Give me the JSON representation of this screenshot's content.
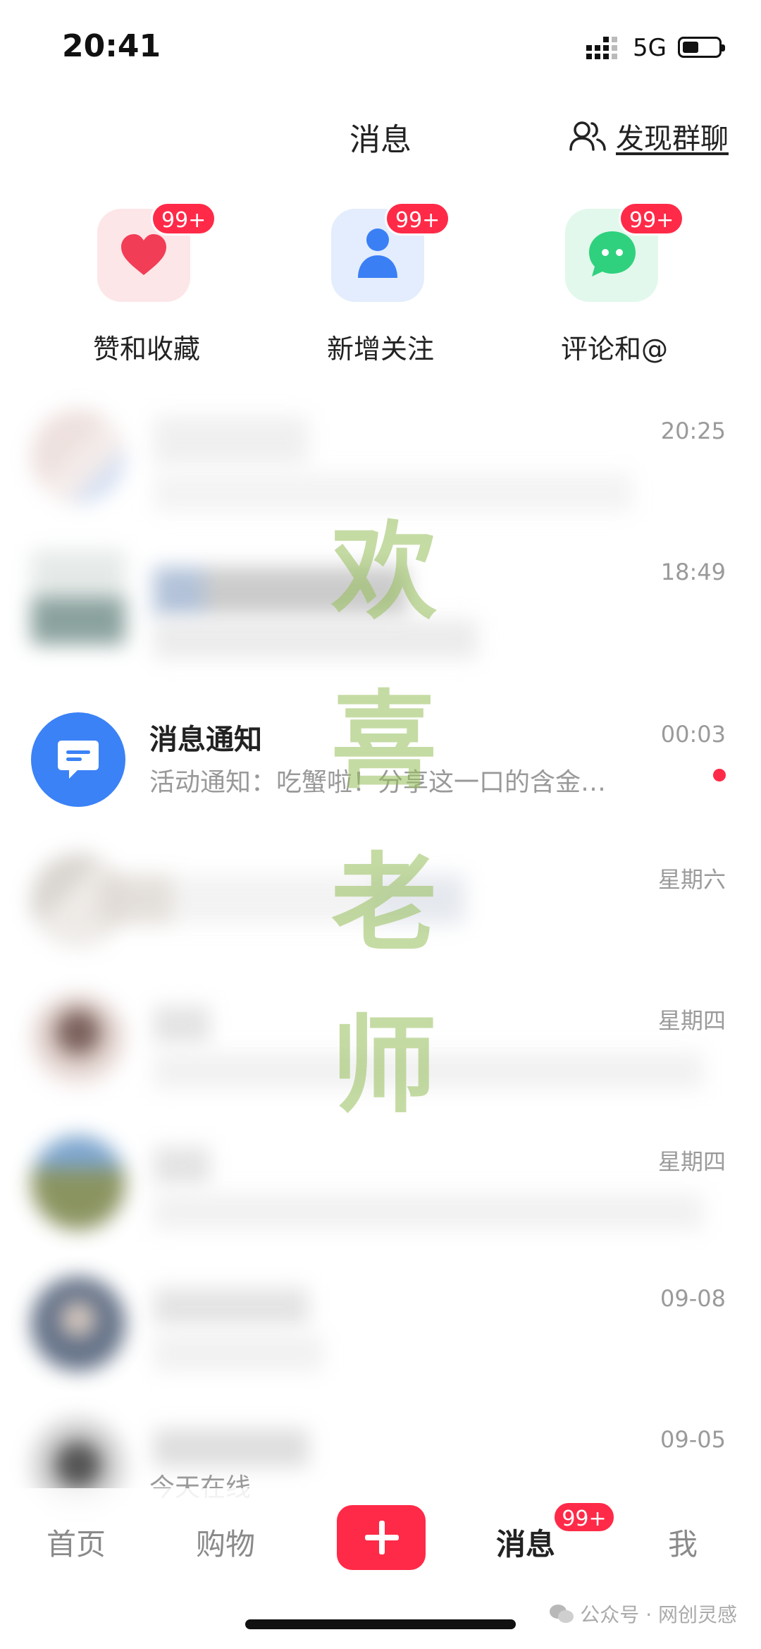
{
  "status_bar": {
    "time": "20:41",
    "network": "5G"
  },
  "header": {
    "title": "消息",
    "discover_label": "发现群聊"
  },
  "quick_actions": [
    {
      "label": "赞和收藏",
      "badge": "99+",
      "icon": "heart-icon",
      "color": "#f23d56"
    },
    {
      "label": "新增关注",
      "badge": "99+",
      "icon": "person-icon",
      "color": "#3b7ff5"
    },
    {
      "label": "评论和@",
      "badge": "99+",
      "icon": "chat-bubble-icon",
      "color": "#2fd17e"
    }
  ],
  "messages": [
    {
      "name": "",
      "preview": "",
      "time": "20:25"
    },
    {
      "name": "",
      "preview": "",
      "time": "18:49"
    },
    {
      "name": "消息通知",
      "preview": "活动通知：吃蟹啦！分享这一口的含金…",
      "time": "00:03",
      "unread": true,
      "icon": "notification-icon"
    },
    {
      "name": "",
      "preview": "",
      "time": "星期六"
    },
    {
      "name": "",
      "preview": "",
      "time": "星期四"
    },
    {
      "name": "",
      "preview": "",
      "time": "星期四"
    },
    {
      "name": "",
      "preview": "",
      "time": "09-08"
    },
    {
      "name": "",
      "preview": "今天在线",
      "time": "09-05"
    }
  ],
  "watermark": [
    "欢",
    "喜",
    "老",
    "师"
  ],
  "tab_bar": {
    "home": "首页",
    "shop": "购物",
    "messages": "消息",
    "messages_badge": "99+",
    "me": "我"
  },
  "credit": "公众号 · 网创灵感",
  "colors": {
    "accent": "#ff2a48",
    "notify_blue": "#3b82f6"
  }
}
